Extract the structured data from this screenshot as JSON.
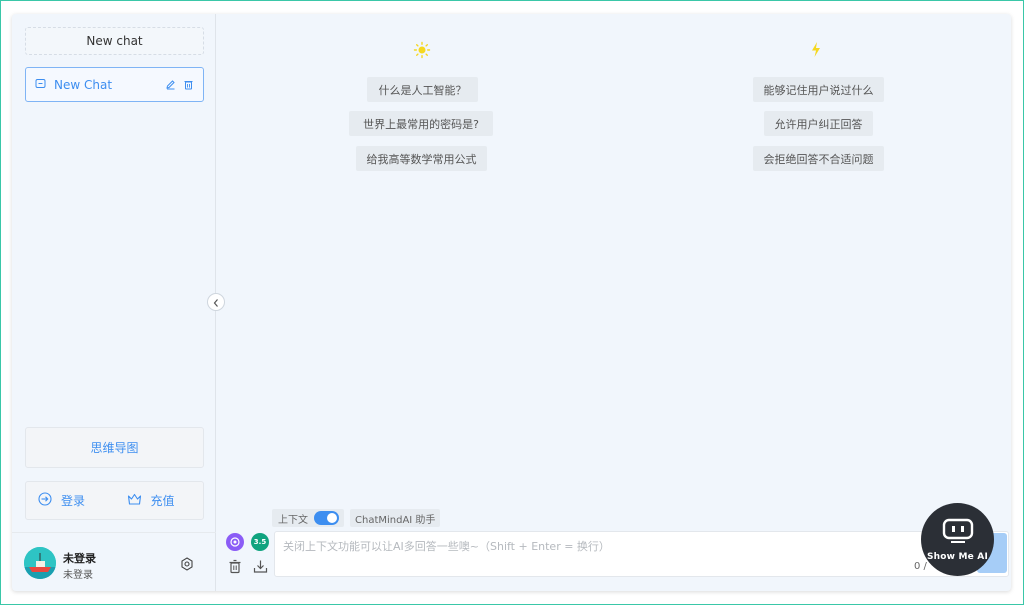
{
  "sidebar": {
    "new_chat_label": "New chat",
    "chats": [
      {
        "label": "New Chat"
      }
    ],
    "mindmap_label": "思维导图",
    "login_label": "登录",
    "recharge_label": "充值",
    "user": {
      "name": "未登录",
      "status": "未登录"
    }
  },
  "main": {
    "columns": [
      {
        "icon": "sun-icon",
        "suggestions": [
          "什么是人工智能？",
          "世界上最常用的密码是?",
          "给我高等数学常用公式"
        ]
      },
      {
        "icon": "lightning-icon",
        "suggestions": [
          "能够记住用户说过什么",
          "允许用户纠正回答",
          "会拒绝回答不合适问题"
        ]
      }
    ]
  },
  "input": {
    "context_label": "上下文",
    "context_enabled": true,
    "assistant_label": "ChatMindAI 助手",
    "model_badge": "3.5",
    "placeholder": "关闭上下文功能可以让AI多回答一些噢~（Shift + Enter = 换行）",
    "value": "",
    "counter": "0 / "
  },
  "floating_logo": {
    "text": "Show Me AI"
  },
  "colors": {
    "accent": "#3d8ef0",
    "background": "#f1f6fc",
    "frame": "#3ac7a8"
  }
}
